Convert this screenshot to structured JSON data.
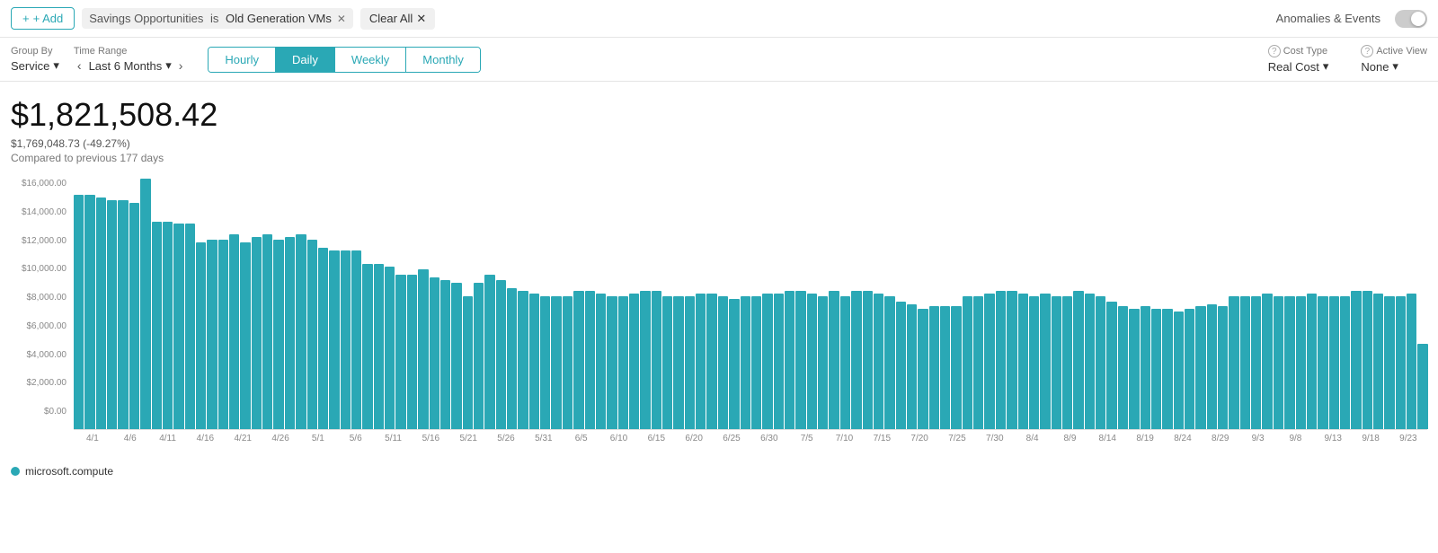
{
  "topbar": {
    "add_label": "+ Add",
    "filter": {
      "field": "Savings Opportunities",
      "operator": "is",
      "value": "Old Generation VMs"
    },
    "clear_all_label": "Clear All",
    "anomalies_label": "Anomalies & Events"
  },
  "controls": {
    "group_by_label": "Group By",
    "group_by_value": "Service",
    "time_range_label": "Time Range",
    "time_range_value": "Last 6 Months",
    "tabs": [
      {
        "label": "Hourly",
        "active": false
      },
      {
        "label": "Daily",
        "active": true
      },
      {
        "label": "Weekly",
        "active": false
      },
      {
        "label": "Monthly",
        "active": false
      }
    ],
    "cost_type_label": "Cost Type",
    "cost_type_value": "Real Cost",
    "active_view_label": "Active View",
    "active_view_value": "None"
  },
  "summary": {
    "total": "$1,821,508.42",
    "comparison_amount": "$1,769,048.73 (-49.27%)",
    "comparison_label": "Compared to previous 177 days"
  },
  "chart": {
    "y_labels": [
      "$16,000.00",
      "$14,000.00",
      "$12,000.00",
      "$10,000.00",
      "$8,000.00",
      "$6,000.00",
      "$4,000.00",
      "$2,000.00",
      "$0.00"
    ],
    "x_labels": [
      "4/1",
      "4/6",
      "4/11",
      "4/16",
      "4/21",
      "4/26",
      "5/1",
      "5/6",
      "5/11",
      "5/16",
      "5/21",
      "5/26",
      "5/31",
      "6/5",
      "6/10",
      "6/15",
      "6/20",
      "6/25",
      "6/30",
      "7/5",
      "7/10",
      "7/15",
      "7/20",
      "7/25",
      "7/30",
      "8/4",
      "8/9",
      "8/14",
      "8/19",
      "8/24",
      "8/29",
      "9/3",
      "9/8",
      "9/13",
      "9/18",
      "9/23"
    ],
    "bars": [
      88,
      88,
      87,
      86,
      86,
      85,
      94,
      78,
      78,
      77,
      77,
      70,
      71,
      71,
      73,
      70,
      72,
      73,
      71,
      72,
      73,
      71,
      68,
      67,
      67,
      67,
      62,
      62,
      61,
      58,
      58,
      60,
      57,
      56,
      55,
      50,
      55,
      58,
      56,
      53,
      52,
      51,
      50,
      50,
      50,
      52,
      52,
      51,
      50,
      50,
      51,
      52,
      52,
      50,
      50,
      50,
      51,
      51,
      50,
      49,
      50,
      50,
      51,
      51,
      52,
      52,
      51,
      50,
      52,
      50,
      52,
      52,
      51,
      50,
      48,
      47,
      45,
      46,
      46,
      46,
      50,
      50,
      51,
      52,
      52,
      51,
      50,
      51,
      50,
      50,
      52,
      51,
      50,
      48,
      46,
      45,
      46,
      45,
      45,
      44,
      45,
      46,
      47,
      46,
      50,
      50,
      50,
      51,
      50,
      50,
      50,
      51,
      50,
      50,
      50,
      52,
      52,
      51,
      50,
      50,
      51,
      32
    ],
    "max_value": 94,
    "legend_label": "microsoft.compute"
  }
}
